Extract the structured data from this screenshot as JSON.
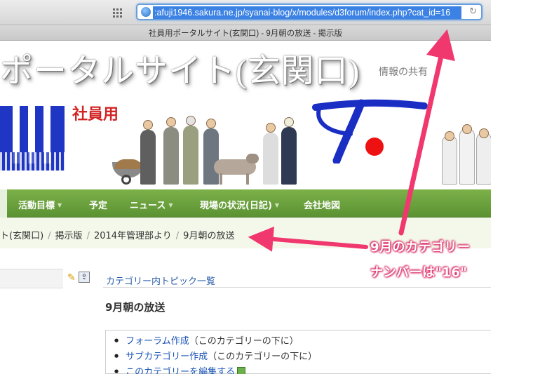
{
  "browser": {
    "url": ":afuji1946.sakura.ne.jp/syanai-blog/x/modules/d3forum/index.php?cat_id=16",
    "tab_title": "社員用ポータルサイト(玄関口) - 9月朝の放送 - 掲示版"
  },
  "header": {
    "site_title": "ポータルサイト(玄関口)",
    "tagline": "情報の共有",
    "banner_label": "社員用"
  },
  "nav": {
    "items": [
      {
        "label": "活動目標",
        "has_menu": true
      },
      {
        "label": "予定",
        "has_menu": false
      },
      {
        "label": "ニュース",
        "has_menu": true
      },
      {
        "label": "現場の状況(日記)",
        "has_menu": true
      },
      {
        "label": "会社地図",
        "has_menu": false
      }
    ]
  },
  "breadcrumb": {
    "items": [
      "ト(玄関口)",
      "掲示版",
      "2014年管理部より",
      "9月朝の放送"
    ]
  },
  "content": {
    "topics_link": "カテゴリー内トピック一覧",
    "category_title": "9月朝の放送",
    "actions": [
      {
        "link": "フォーラム作成",
        "suffix": "（このカテゴリーの下に）"
      },
      {
        "link": "サブカテゴリー作成",
        "suffix": "（このカテゴリーの下に）"
      },
      {
        "link": "このカテゴリーを編集する",
        "suffix": ""
      }
    ]
  },
  "annotation": {
    "line1": "9月のカテゴリー",
    "line2": "ナンバーは\"16\"",
    "color": "#f0386f"
  },
  "icons": [
    "grid-icon",
    "globe-icon",
    "reload-icon",
    "pencil-icon",
    "upload-icon",
    "edit-icon"
  ]
}
